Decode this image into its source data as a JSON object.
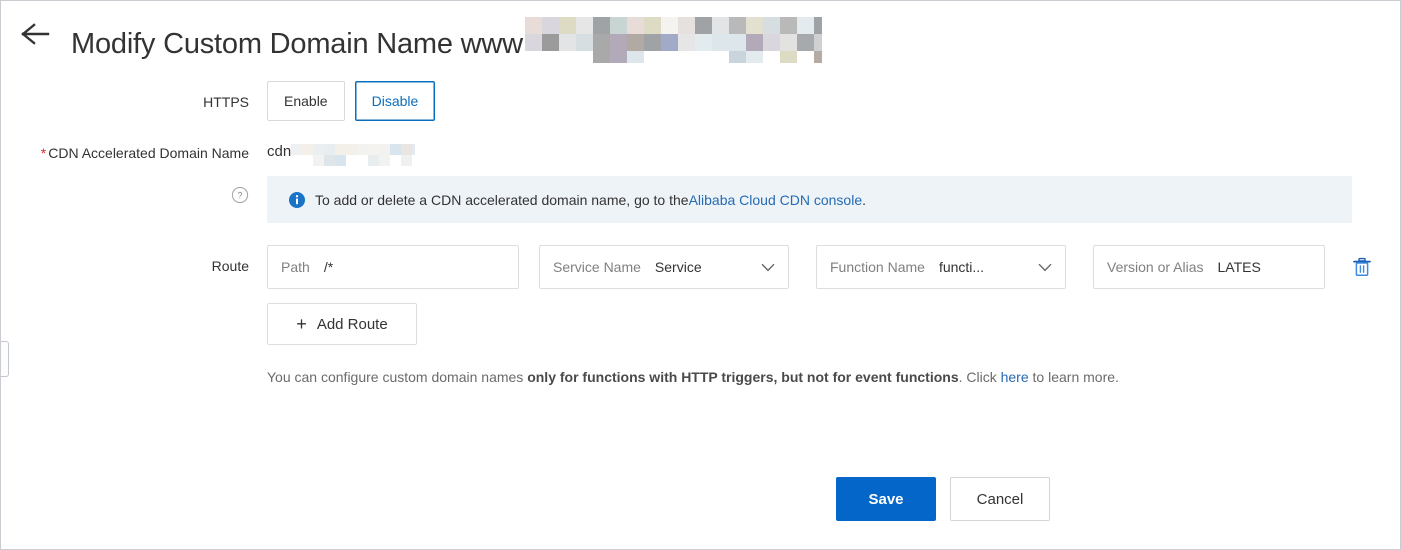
{
  "header": {
    "back_icon": "arrow-left-icon",
    "title_prefix": "Modify Custom Domain Name www",
    "title_redacted": true
  },
  "form": {
    "https": {
      "label": "HTTPS",
      "options": [
        "Enable",
        "Disable"
      ],
      "enable_label": "Enable",
      "disable_label": "Disable",
      "selected": "Disable"
    },
    "cdn_domain": {
      "label": "CDN Accelerated Domain Name",
      "required_marker": "*",
      "value_prefix": "cdn",
      "value_redacted": true
    },
    "notice": {
      "help_icon": "question-circle-icon",
      "info_icon": "info-circle-icon",
      "text_before": "To add or delete a CDN accelerated domain name, go to the ",
      "link_text": "Alibaba Cloud CDN console",
      "text_after": " ."
    },
    "route": {
      "label": "Route",
      "fields": [
        {
          "label": "Path",
          "value": "/*",
          "has_caret": false
        },
        {
          "label": "Service Name",
          "value": "Service",
          "has_caret": true
        },
        {
          "label": "Function Name",
          "value": "functi...",
          "has_caret": true
        },
        {
          "label": "Version or Alias",
          "value": "LATES",
          "has_caret": false
        }
      ],
      "delete_icon": "trash-icon",
      "add_route_label": "Add Route",
      "add_route_icon": "plus-icon"
    },
    "helper": {
      "text_1": "You can configure custom domain names ",
      "bold_1": "only for functions with HTTP triggers, but not for event functions",
      "text_2": ". Click ",
      "link": "here",
      "text_3": " to learn more."
    }
  },
  "actions": {
    "save_label": "Save",
    "cancel_label": "Cancel"
  },
  "colors": {
    "primary_blue": "#0566c9",
    "link_blue": "#246bb3",
    "active_border": "#0a6ebd",
    "required_red": "#d93026",
    "notice_bg": "#eef3f8"
  }
}
